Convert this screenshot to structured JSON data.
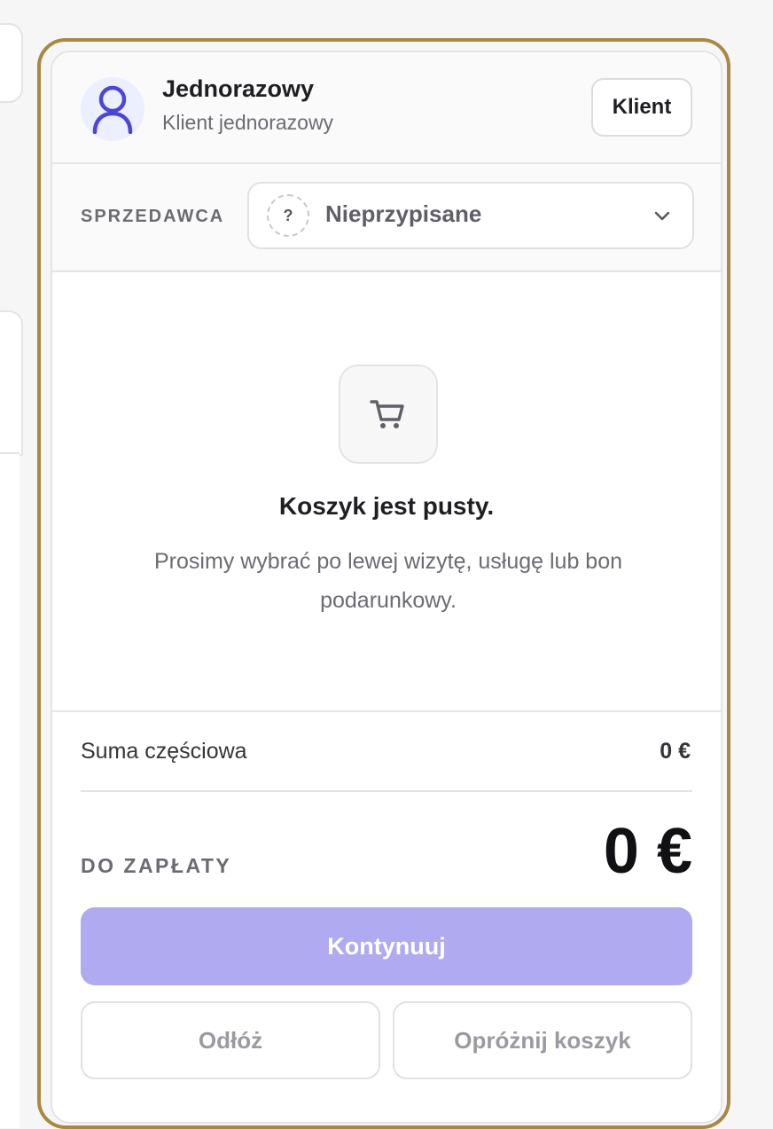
{
  "client": {
    "name": "Jednorazowy",
    "subtitle": "Klient jednorazowy",
    "button_label": "Klient",
    "avatar_icon": "user-icon"
  },
  "seller": {
    "label": "SPRZEDAWCA",
    "placeholder_symbol": "?",
    "value": "Nieprzypisane",
    "icon": "chevron-down-icon"
  },
  "cart": {
    "icon": "cart-icon",
    "empty_title": "Koszyk jest pusty.",
    "empty_description": "Prosimy wybrać po lewej wizytę, usługę lub bon podarunkowy."
  },
  "totals": {
    "subtotal_label": "Suma częściowa",
    "subtotal_value": "0 €",
    "due_label": "DO ZAPŁATY",
    "due_value": "0 €"
  },
  "actions": {
    "continue_label": "Kontynuuj",
    "postpone_label": "Odłóż",
    "clear_label": "Opróżnij koszyk"
  },
  "colors": {
    "accent": "#b0aaf1",
    "frame": "#a98844",
    "avatar_bg": "#ecefff",
    "avatar_icon": "#4c46d6"
  }
}
